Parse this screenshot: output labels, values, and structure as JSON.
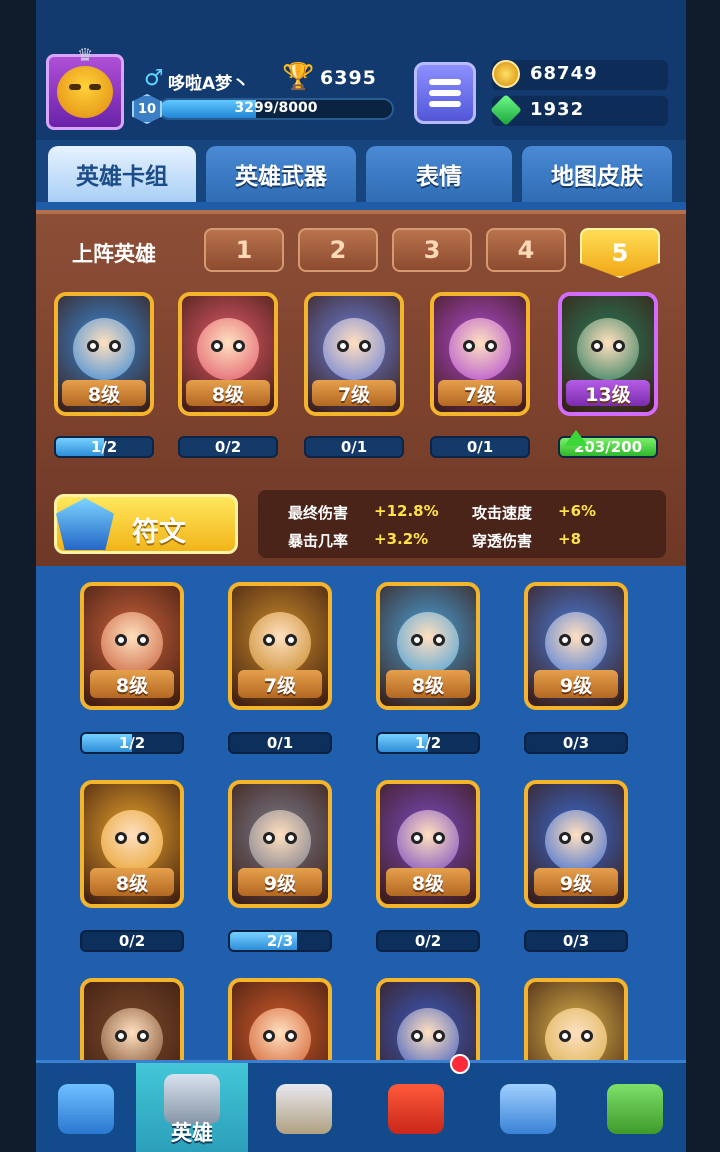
{
  "header": {
    "gender_icon": "male-symbol-icon",
    "player_name": "哆啦A梦丶",
    "trophies": "6395",
    "level": "10",
    "xp_text": "3299/8000",
    "xp_progress": 0.412,
    "gold": "68749",
    "gems": "1932"
  },
  "tabs": [
    {
      "label": "英雄卡组",
      "active": true
    },
    {
      "label": "英雄武器",
      "active": false
    },
    {
      "label": "表情",
      "active": false
    },
    {
      "label": "地图皮肤",
      "active": false
    }
  ],
  "deck": {
    "label": "上阵英雄",
    "slots": [
      "1",
      "2",
      "3",
      "4",
      "5"
    ],
    "active_slot": "5",
    "heroes": [
      {
        "level": "8级",
        "progress": "1/2",
        "fill": 0.5,
        "color": "#3a8ad8"
      },
      {
        "level": "8级",
        "progress": "0/2",
        "fill": 0,
        "color": "#e05a6a"
      },
      {
        "level": "7级",
        "progress": "0/1",
        "fill": 0,
        "color": "#6a80d8"
      },
      {
        "level": "7级",
        "progress": "0/1",
        "fill": 0,
        "color": "#b04ad0"
      },
      {
        "level": "13级",
        "progress": "203/200",
        "fill": 1,
        "color": "#2a7a5a"
      }
    ],
    "rune_label": "符文",
    "stats": [
      {
        "label": "最终伤害",
        "value": "+12.8%"
      },
      {
        "label": "攻击速度",
        "value": "+6%"
      },
      {
        "label": "暴击几率",
        "value": "+3.2%"
      },
      {
        "label": "穿透伤害",
        "value": "+8"
      }
    ]
  },
  "collection": [
    {
      "level": "8级",
      "progress": "1/2",
      "fill": 0.5,
      "color": "#c8603a"
    },
    {
      "level": "7级",
      "progress": "0/1",
      "fill": 0,
      "color": "#c8892a"
    },
    {
      "level": "8级",
      "progress": "1/2",
      "fill": 0.5,
      "color": "#4aa0d8"
    },
    {
      "level": "9级",
      "progress": "0/3",
      "fill": 0,
      "color": "#4a7ad8"
    },
    {
      "level": "8级",
      "progress": "0/2",
      "fill": 0,
      "color": "#e6a02a"
    },
    {
      "level": "9级",
      "progress": "2/3",
      "fill": 0.667,
      "color": "#7a7a8a"
    },
    {
      "level": "8级",
      "progress": "0/2",
      "fill": 0,
      "color": "#7a4ac0"
    },
    {
      "level": "9级",
      "progress": "0/3",
      "fill": 0,
      "color": "#3a6ad0"
    },
    {
      "level": "",
      "progress": "",
      "fill": 0,
      "color": "#7a4a2a"
    },
    {
      "level": "",
      "progress": "",
      "fill": 0,
      "color": "#d05a2a"
    },
    {
      "level": "",
      "progress": "",
      "fill": 0,
      "color": "#3a5ac0"
    },
    {
      "level": "",
      "progress": "",
      "fill": 0,
      "color": "#d8b04a"
    }
  ],
  "nav": [
    {
      "icon": "treasure-chest-icon",
      "label": ""
    },
    {
      "icon": "knight-helmet-icon",
      "label": "英雄"
    },
    {
      "icon": "crossed-swords-icon",
      "label": ""
    },
    {
      "icon": "crown-shield-icon",
      "label": ""
    },
    {
      "icon": "friends-icon",
      "label": ""
    },
    {
      "icon": "sprout-island-icon",
      "label": ""
    }
  ],
  "colors": {
    "panel_blue": "#1e5ca8",
    "deck_brown": "#8d4e36",
    "gold_border": "#f4b52c",
    "stat_yellow": "#ffe24a",
    "active_nav": "#43c7d8"
  }
}
